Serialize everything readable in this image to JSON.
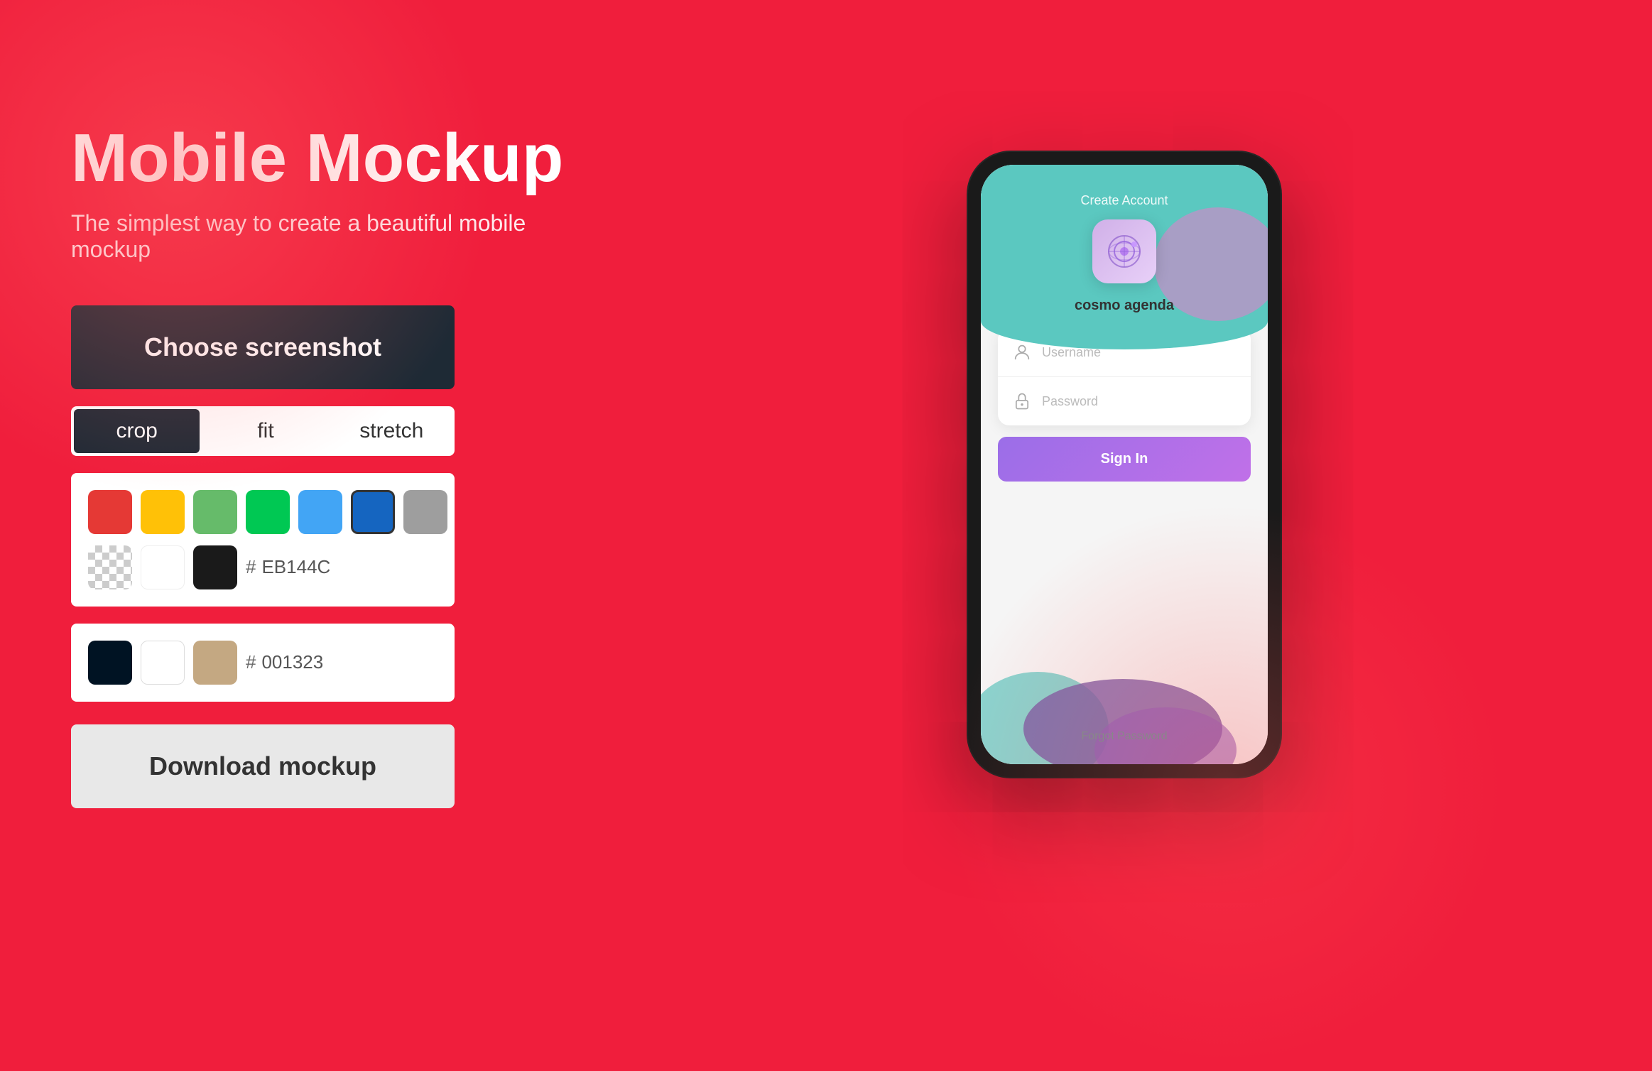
{
  "app": {
    "title": "Mobile Mockup",
    "subtitle": "The simplest way to create a beautiful mobile mockup",
    "brand_color": "#F01E3C"
  },
  "left_panel": {
    "choose_btn_label": "Choose screenshot",
    "download_btn_label": "Download mockup",
    "mode_selector": {
      "modes": [
        {
          "id": "crop",
          "label": "crop",
          "active": true
        },
        {
          "id": "fit",
          "label": "fit",
          "active": false
        },
        {
          "id": "stretch",
          "label": "stretch",
          "active": false
        }
      ]
    },
    "color_panel_1": {
      "swatches": [
        {
          "id": "red",
          "color": "#E53935",
          "label": "Red"
        },
        {
          "id": "orange",
          "color": "#FFC107",
          "label": "Orange"
        },
        {
          "id": "light-green",
          "color": "#66BB6A",
          "label": "Light Green"
        },
        {
          "id": "green",
          "color": "#00C853",
          "label": "Green"
        },
        {
          "id": "light-blue",
          "color": "#42A5F5",
          "label": "Light Blue"
        },
        {
          "id": "blue",
          "color": "#1565C0",
          "label": "Blue"
        },
        {
          "id": "gray",
          "color": "#9E9E9E",
          "label": "Gray"
        }
      ],
      "row2_swatches": [
        {
          "id": "checkered",
          "color": "transparent",
          "label": "Transparent"
        },
        {
          "id": "white",
          "color": "#ffffff",
          "label": "White"
        },
        {
          "id": "black",
          "color": "#1a1a1a",
          "label": "Black"
        }
      ],
      "hex_value": "EB144C",
      "hash_symbol": "#"
    },
    "color_panel_2": {
      "swatches": [
        {
          "id": "dark-navy",
          "color": "#001323",
          "label": "Dark Navy"
        },
        {
          "id": "white2",
          "color": "#ffffff",
          "label": "White"
        },
        {
          "id": "tan",
          "color": "#C4A882",
          "label": "Tan"
        }
      ],
      "hex_value": "001323",
      "hash_symbol": "#"
    }
  },
  "phone_mockup": {
    "screen": {
      "create_account_label": "Create Account",
      "app_name": "cosmo agenda",
      "username_placeholder": "Username",
      "password_placeholder": "Password",
      "sign_in_label": "Sign In",
      "forgot_password_label": "Forgot Password"
    }
  }
}
